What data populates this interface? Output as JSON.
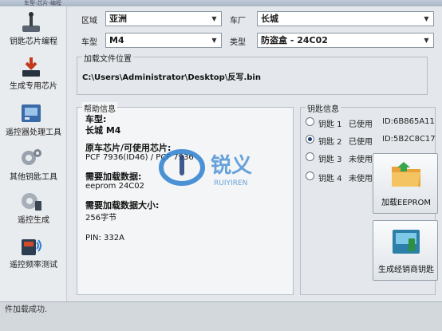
{
  "window": {
    "title": "车型-芯片-编程"
  },
  "sidebar": {
    "items": [
      {
        "label": "钥匙芯片编程",
        "icon": "programming-tool-icon"
      },
      {
        "label": "生成专用芯片",
        "icon": "download-chip-icon"
      },
      {
        "label": "遥控器处理工具",
        "icon": "remote-tool-icon"
      },
      {
        "label": "其他钥匙工具",
        "icon": "gears-icon"
      },
      {
        "label": "遥控生成",
        "icon": "gear-remote-icon"
      },
      {
        "label": "遥控频率测试",
        "icon": "frequency-test-icon"
      }
    ]
  },
  "filters": {
    "region_label": "区域",
    "region_value": "亚洲",
    "brand_label": "车厂",
    "brand_value": "长城",
    "model_label": "车型",
    "model_value": "M4",
    "type_label": "类型",
    "type_value": "防盗盒 - 24C02"
  },
  "file_location": {
    "title": "加载文件位置",
    "path": "C:\\Users\\Administrator\\Desktop\\反写.bin"
  },
  "help": {
    "title": "帮助信息",
    "model_heading": "车型:",
    "model_value": "长城 M4",
    "chip_heading": "原车芯片/可使用芯片:",
    "chip_value": "PCF 7936(ID46) / PCF 7936",
    "data_heading": "需要加载数据:",
    "data_value": "eeprom 24C02",
    "size_heading": "需要加载数据大小:",
    "size_value": "256字节",
    "pin": "PIN: 332A"
  },
  "keys": {
    "title": "钥匙信息",
    "rows": [
      {
        "name": "钥匙 1",
        "status": "已使用",
        "id": "ID:6B865A11",
        "selected": false
      },
      {
        "name": "钥匙 2",
        "status": "已使用",
        "id": "ID:5B2C8C17",
        "selected": true
      },
      {
        "name": "钥匙 3",
        "status": "未使用",
        "id": "———",
        "selected": false
      },
      {
        "name": "钥匙 4",
        "status": "未使用",
        "id": "———",
        "selected": false
      }
    ]
  },
  "actions": {
    "load_eeprom": "加载EEPROM",
    "generate_dealer_key": "生成经销商钥匙"
  },
  "status": {
    "text": "件加载成功."
  },
  "watermark": {
    "text": "锐义",
    "subtext": "RUIYIREN"
  },
  "colors": {
    "combo_border": "#8a96a3",
    "panel_bg": "#e4e8ec",
    "accent": "#1a3b6e"
  }
}
